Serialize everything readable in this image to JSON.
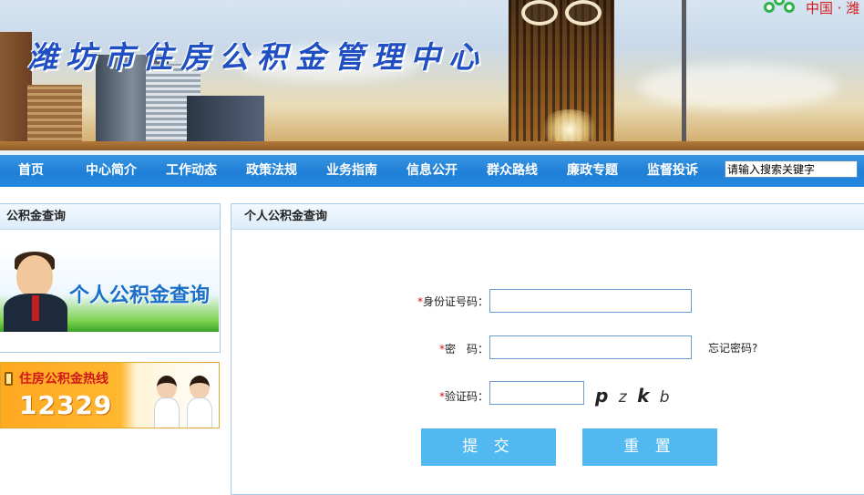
{
  "header": {
    "site_title": "潍坊市住房公积金管理中心",
    "region_text": "中国 · 潍"
  },
  "nav": {
    "items": [
      {
        "label": "首页"
      },
      {
        "label": "中心简介"
      },
      {
        "label": "工作动态"
      },
      {
        "label": "政策法规"
      },
      {
        "label": "业务指南"
      },
      {
        "label": "信息公开"
      },
      {
        "label": "群众路线"
      },
      {
        "label": "廉政专题"
      },
      {
        "label": "监督投诉"
      }
    ],
    "search_value": "请输入搜索关键字"
  },
  "sidebar": {
    "title": "公积金查询",
    "promo_query_text": "个人公积金查询",
    "hotline_title": "住房公积金热线",
    "hotline_number": "12329"
  },
  "main": {
    "title": "个人公积金查询",
    "form": {
      "required_mark": "*",
      "id_label": "身份证号码：",
      "password_label": "密　码：",
      "captcha_label": "验证码：",
      "forgot_password": "忘记密码?",
      "captcha_text": [
        "p",
        "z",
        "k",
        "b"
      ],
      "submit_label": "提 交",
      "reset_label": "重 置"
    }
  },
  "colors": {
    "nav_blue": "#1f7fd6",
    "button_blue": "#52b8f0",
    "title_blue": "#1f4fc2",
    "required_red": "#e01010"
  }
}
